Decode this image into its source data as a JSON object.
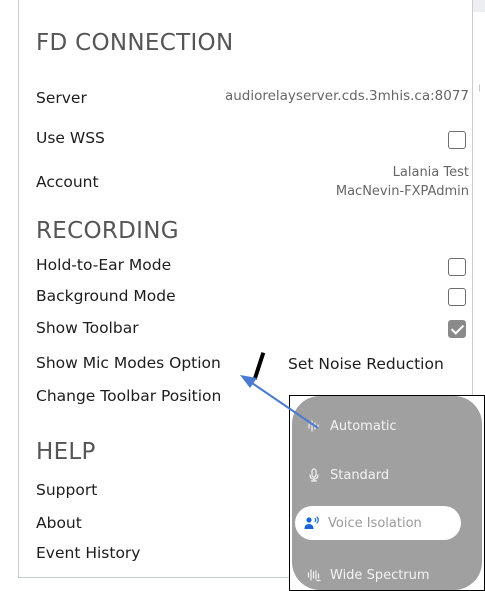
{
  "fd_connection": {
    "title": "FD CONNECTION",
    "server_label": "Server",
    "server_value": "audiorelayserver.cds.3mhis.ca:8077",
    "use_wss_label": "Use WSS",
    "use_wss_checked": false,
    "account_label": "Account",
    "account_line1": "Lalania Test",
    "account_line2": "MacNevin-FXPAdmin"
  },
  "recording": {
    "title": "RECORDING",
    "hold_to_ear_label": "Hold-to-Ear Mode",
    "hold_to_ear_checked": false,
    "background_mode_label": "Background Mode",
    "background_mode_checked": false,
    "show_toolbar_label": "Show Toolbar",
    "show_toolbar_checked": true,
    "show_mic_modes_label": "Show Mic Modes Option",
    "change_toolbar_position_label": "Change Toolbar Position"
  },
  "annotation": {
    "text": "Set Noise Reduction"
  },
  "help": {
    "title": "HELP",
    "support_label": "Support",
    "about_label": "About",
    "event_history_label": "Event History"
  },
  "mic_modes": {
    "items": [
      {
        "label": "Automatic",
        "icon": "waveform-auto-icon",
        "selected": false
      },
      {
        "label": "Standard",
        "icon": "microphone-icon",
        "selected": false
      },
      {
        "label": "Voice Isolation",
        "icon": "person-voice-icon",
        "selected": true
      },
      {
        "label": "Wide Spectrum",
        "icon": "waveform-wide-icon",
        "selected": false
      }
    ],
    "accent_color": "#1a64d8"
  },
  "colors": {
    "arrow": "#4a7bd0",
    "popover_bg": "#a0a0a0"
  }
}
